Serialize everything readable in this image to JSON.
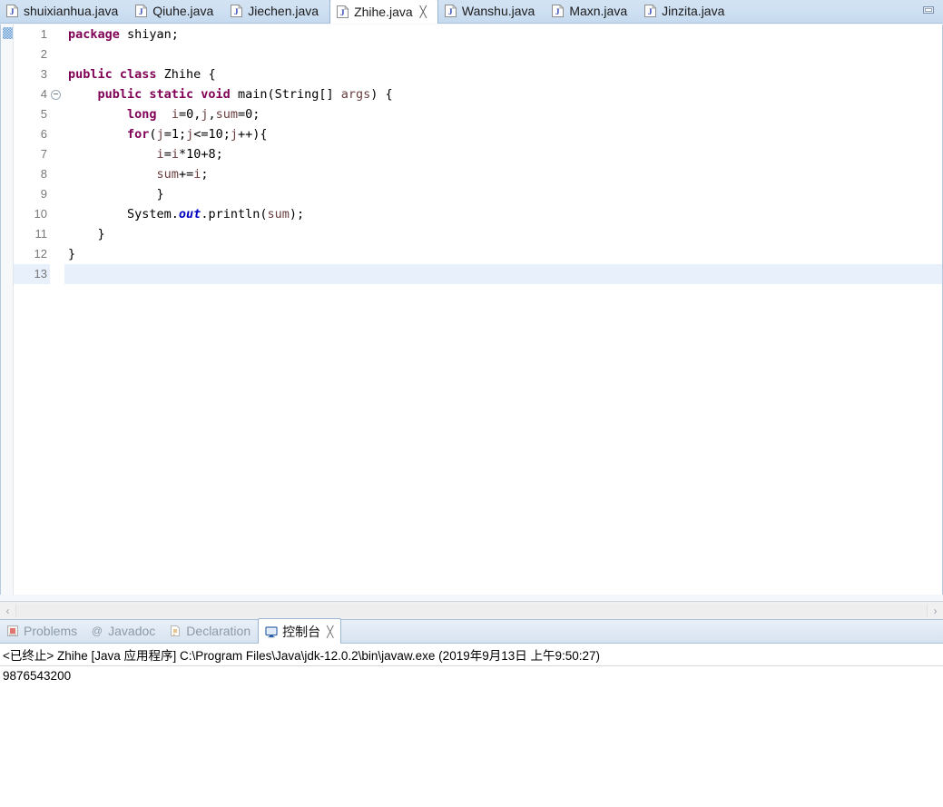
{
  "editor": {
    "tabs": [
      {
        "label": "shuixianhua.java",
        "icon": "java-file-icon",
        "active": false,
        "closable": false
      },
      {
        "label": "Qiuhe.java",
        "icon": "java-file-icon",
        "active": false,
        "closable": false
      },
      {
        "label": "Jiechen.java",
        "icon": "java-file-icon",
        "active": false,
        "closable": false
      },
      {
        "label": "Zhihe.java",
        "icon": "java-file-icon",
        "active": true,
        "closable": true
      },
      {
        "label": "Wanshu.java",
        "icon": "java-file-icon",
        "active": false,
        "closable": false
      },
      {
        "label": "Maxn.java",
        "icon": "java-file-icon",
        "active": false,
        "closable": false
      },
      {
        "label": "Jinzita.java",
        "icon": "java-file-icon",
        "active": false,
        "closable": false
      }
    ],
    "close_glyph": "╳",
    "minimize_button": "minimize-icon",
    "lines": [
      {
        "n": "1",
        "fold": false,
        "current": false,
        "tokens": [
          {
            "t": "package ",
            "c": "kw"
          },
          {
            "t": "shiyan;",
            "c": "pln"
          }
        ]
      },
      {
        "n": "2",
        "fold": false,
        "current": false,
        "tokens": []
      },
      {
        "n": "3",
        "fold": false,
        "current": false,
        "tokens": [
          {
            "t": "public class ",
            "c": "kw"
          },
          {
            "t": "Zhihe {",
            "c": "pln"
          }
        ]
      },
      {
        "n": "4",
        "fold": true,
        "current": false,
        "tokens": [
          {
            "t": "    ",
            "c": "pln"
          },
          {
            "t": "public static void ",
            "c": "kw"
          },
          {
            "t": "main(String[] ",
            "c": "pln"
          },
          {
            "t": "args",
            "c": "loc"
          },
          {
            "t": ") {",
            "c": "pln"
          }
        ]
      },
      {
        "n": "5",
        "fold": false,
        "current": false,
        "tokens": [
          {
            "t": "        ",
            "c": "pln"
          },
          {
            "t": "long ",
            "c": "kw"
          },
          {
            "t": " ",
            "c": "pln"
          },
          {
            "t": "i",
            "c": "loc"
          },
          {
            "t": "=0,",
            "c": "pln"
          },
          {
            "t": "j",
            "c": "loc"
          },
          {
            "t": ",",
            "c": "pln"
          },
          {
            "t": "sum",
            "c": "loc"
          },
          {
            "t": "=0;",
            "c": "pln"
          }
        ]
      },
      {
        "n": "6",
        "fold": false,
        "current": false,
        "tokens": [
          {
            "t": "        ",
            "c": "pln"
          },
          {
            "t": "for",
            "c": "kw"
          },
          {
            "t": "(",
            "c": "pln"
          },
          {
            "t": "j",
            "c": "loc"
          },
          {
            "t": "=1;",
            "c": "pln"
          },
          {
            "t": "j",
            "c": "loc"
          },
          {
            "t": "<=10;",
            "c": "pln"
          },
          {
            "t": "j",
            "c": "loc"
          },
          {
            "t": "++){",
            "c": "pln"
          }
        ]
      },
      {
        "n": "7",
        "fold": false,
        "current": false,
        "tokens": [
          {
            "t": "            ",
            "c": "pln"
          },
          {
            "t": "i",
            "c": "loc"
          },
          {
            "t": "=",
            "c": "pln"
          },
          {
            "t": "i",
            "c": "loc"
          },
          {
            "t": "*10+8;",
            "c": "pln"
          }
        ]
      },
      {
        "n": "8",
        "fold": false,
        "current": false,
        "tokens": [
          {
            "t": "            ",
            "c": "pln"
          },
          {
            "t": "sum",
            "c": "loc"
          },
          {
            "t": "+=",
            "c": "pln"
          },
          {
            "t": "i",
            "c": "loc"
          },
          {
            "t": ";",
            "c": "pln"
          }
        ]
      },
      {
        "n": "9",
        "fold": false,
        "current": false,
        "tokens": [
          {
            "t": "            }",
            "c": "pln"
          }
        ]
      },
      {
        "n": "10",
        "fold": false,
        "current": false,
        "tokens": [
          {
            "t": "        System.",
            "c": "pln"
          },
          {
            "t": "out",
            "c": "fld"
          },
          {
            "t": ".println(",
            "c": "pln"
          },
          {
            "t": "sum",
            "c": "loc"
          },
          {
            "t": ");",
            "c": "pln"
          }
        ]
      },
      {
        "n": "11",
        "fold": false,
        "current": false,
        "tokens": [
          {
            "t": "    }",
            "c": "pln"
          }
        ]
      },
      {
        "n": "12",
        "fold": false,
        "current": false,
        "tokens": [
          {
            "t": "}",
            "c": "pln"
          }
        ]
      },
      {
        "n": "13",
        "fold": false,
        "current": true,
        "tokens": []
      }
    ],
    "hscroll": {
      "left_arrow": "‹",
      "right_arrow": "›"
    }
  },
  "bottom": {
    "tabs": [
      {
        "label": "Problems",
        "icon": "problems-icon",
        "active": false,
        "closable": false
      },
      {
        "label": "Javadoc",
        "icon": "javadoc-at-icon",
        "active": false,
        "closable": false
      },
      {
        "label": "Declaration",
        "icon": "declaration-icon",
        "active": false,
        "closable": false
      },
      {
        "label": "控制台",
        "icon": "console-icon",
        "active": true,
        "closable": true
      }
    ],
    "close_glyph": "╳",
    "console": {
      "header": "<已终止> Zhihe [Java 应用程序] C:\\Program Files\\Java\\jdk-12.0.2\\bin\\javaw.exe  (2019年9月13日 上午9:50:27)",
      "output": "9876543200"
    }
  },
  "colors": {
    "keyword": "#7F0055",
    "field": "#0000C0",
    "local_var": "#6A3E3E",
    "current_line": "#E8F0FC",
    "tab_active_bg": "#FFFFFF",
    "tabbar_bg": "#CFE0F2"
  }
}
